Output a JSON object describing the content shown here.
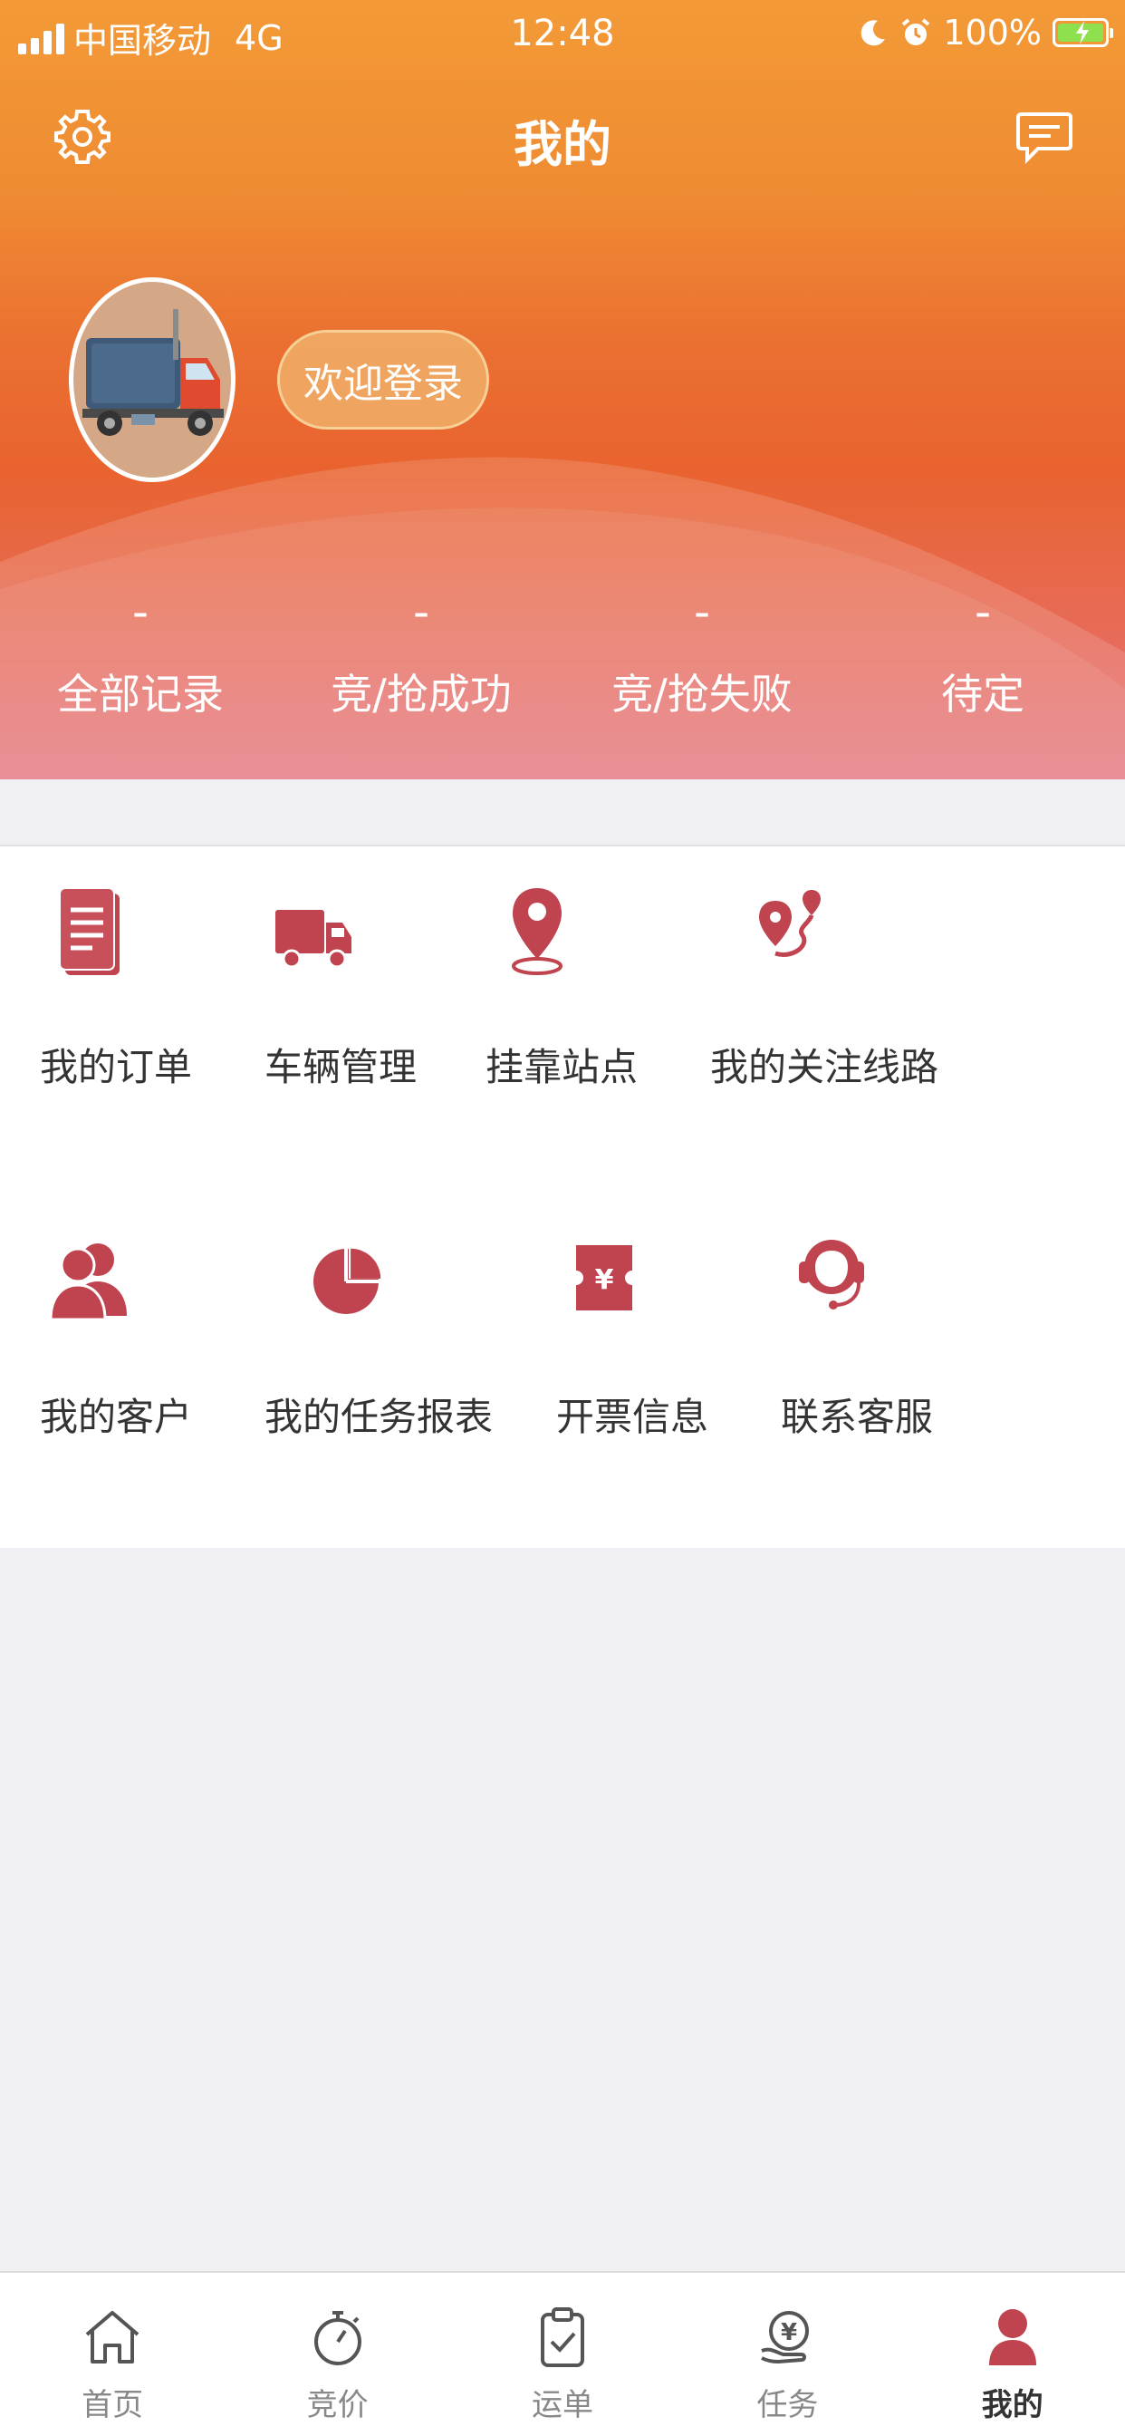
{
  "status_bar": {
    "carrier": "中国移动",
    "network": "4G",
    "time": "12:48",
    "battery": "100%"
  },
  "nav": {
    "title": "我的",
    "settings_icon": "gear-icon",
    "message_icon": "message-icon"
  },
  "profile": {
    "avatar_icon": "truck-avatar",
    "login_label": "欢迎登录"
  },
  "stats": [
    {
      "value": "-",
      "label": "全部记录"
    },
    {
      "value": "-",
      "label": "竞/抢成功"
    },
    {
      "value": "-",
      "label": "竞/抢失败"
    },
    {
      "value": "-",
      "label": "待定"
    }
  ],
  "menu": [
    {
      "label": "我的订单",
      "icon": "document-icon"
    },
    {
      "label": "车辆管理",
      "icon": "truck-icon"
    },
    {
      "label": "挂靠站点",
      "icon": "location-pin-icon"
    },
    {
      "label": "我的关注线路",
      "icon": "route-icon"
    },
    {
      "label": "我的客户",
      "icon": "users-icon"
    },
    {
      "label": "我的任务报表",
      "icon": "pie-chart-icon"
    },
    {
      "label": "开票信息",
      "icon": "invoice-icon"
    },
    {
      "label": "联系客服",
      "icon": "headset-icon"
    }
  ],
  "tabs": [
    {
      "label": "首页",
      "icon": "home-icon"
    },
    {
      "label": "竞价",
      "icon": "stopwatch-icon"
    },
    {
      "label": "运单",
      "icon": "clipboard-check-icon"
    },
    {
      "label": "任务",
      "icon": "yuan-hand-icon"
    },
    {
      "label": "我的",
      "icon": "person-icon",
      "active": true
    }
  ],
  "colors": {
    "accent": "#c0444f",
    "header_top": "#f39a37",
    "header_bottom": "#e5727c"
  }
}
